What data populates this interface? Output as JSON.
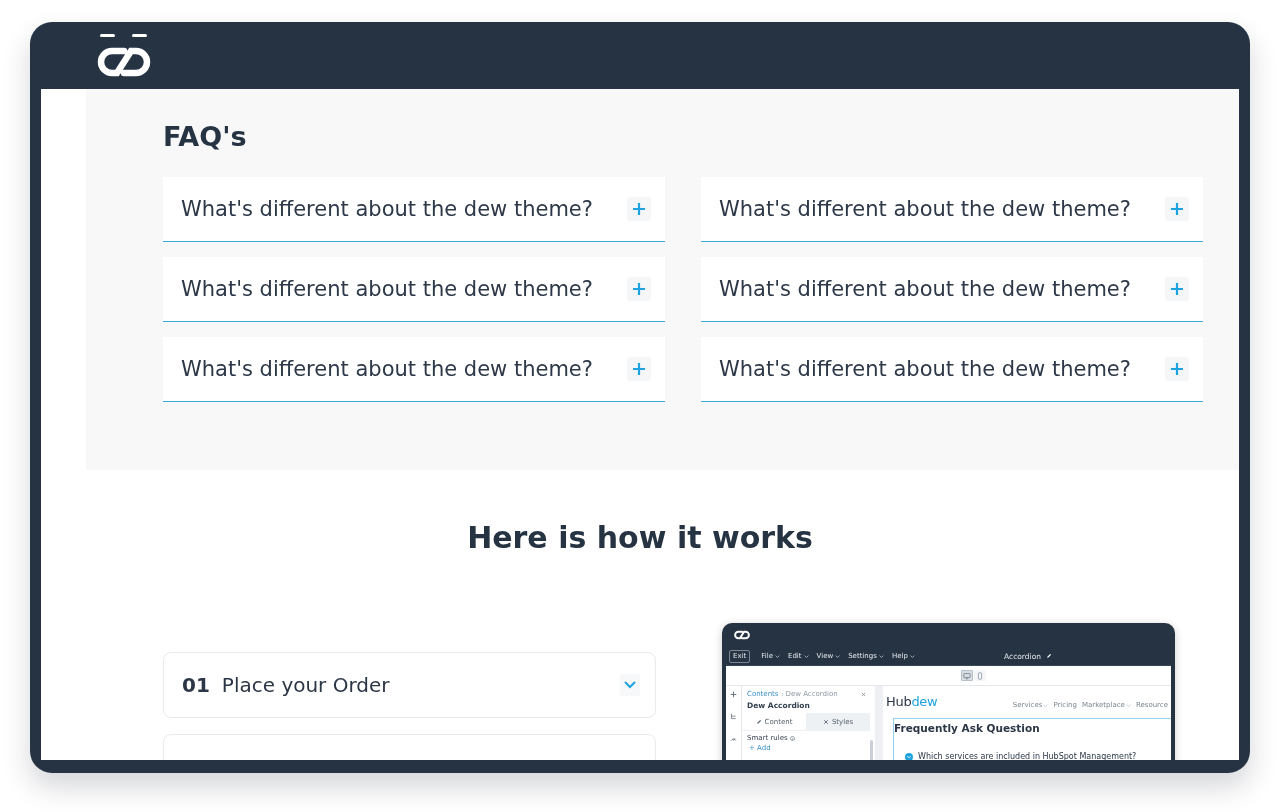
{
  "faq": {
    "title": "FAQ's",
    "items": [
      {
        "question": "What's different about the dew theme?",
        "expanded": false
      },
      {
        "question": "What's different about the dew theme?",
        "expanded": false
      },
      {
        "question": "What's different about the dew theme?",
        "expanded": false
      },
      {
        "question": "What's different about the dew theme?",
        "expanded": false
      },
      {
        "question": "What's different about the dew theme?",
        "expanded": false
      },
      {
        "question": "What's different about the dew theme?",
        "expanded": false
      }
    ]
  },
  "how_it_works": {
    "title": "Here is how it works",
    "steps": [
      {
        "number": "01",
        "title": "Place your Order",
        "expanded": false
      }
    ]
  },
  "editor_preview": {
    "menu": [
      {
        "label": "Exit",
        "kind": "button"
      },
      {
        "label": "File",
        "kind": "dropdown"
      },
      {
        "label": "Edit",
        "kind": "dropdown"
      },
      {
        "label": "View",
        "kind": "dropdown"
      },
      {
        "label": "Settings",
        "kind": "dropdown"
      },
      {
        "label": "Help",
        "kind": "dropdown"
      }
    ],
    "document_title": "Accordion",
    "device_toggles": [
      {
        "kind": "desktop",
        "selected": true
      },
      {
        "kind": "mobile",
        "selected": false
      }
    ],
    "panel": {
      "breadcrumb": [
        {
          "label": "Contents",
          "kind": "link"
        },
        {
          "label": "Dew Accordion",
          "kind": "current"
        }
      ],
      "title": "Dew Accordion",
      "tabs": [
        {
          "label": "Content",
          "kind": "content",
          "selected": true
        },
        {
          "label": "Styles",
          "kind": "styles",
          "selected": false
        }
      ],
      "smart_rules": "Smart rules",
      "add_link": "+ Add"
    },
    "site": {
      "brand_parts": [
        "Hub",
        "dew"
      ],
      "nav": [
        {
          "label": "Services",
          "dropdown": true
        },
        {
          "label": "Pricing",
          "dropdown": false
        },
        {
          "label": "Marketplace",
          "dropdown": true
        },
        {
          "label": "Resource",
          "dropdown": false
        }
      ],
      "heading": "Frequently Ask Question",
      "questions": [
        {
          "text": "Which services are included in HubSpot Management?"
        }
      ]
    }
  }
}
